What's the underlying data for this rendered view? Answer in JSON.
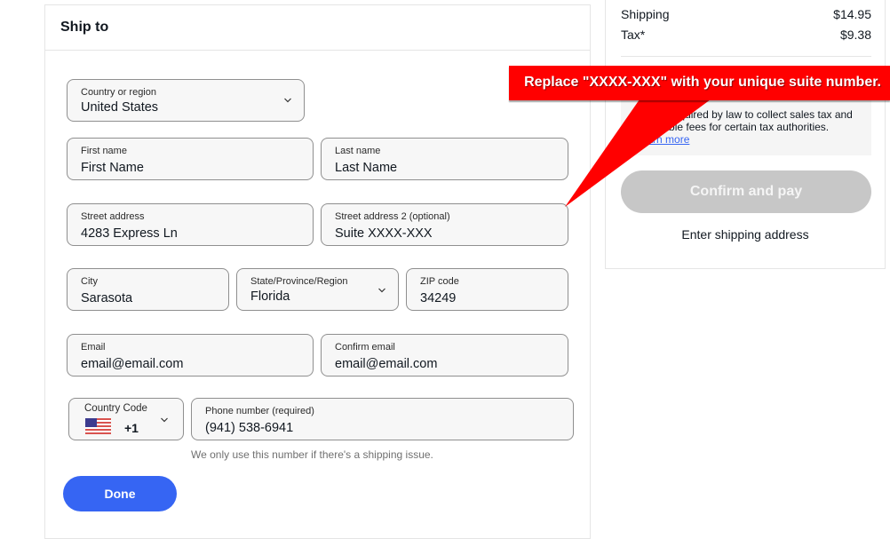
{
  "ship_to": {
    "title": "Ship to",
    "country": {
      "label": "Country or region",
      "value": "United States"
    },
    "first_name": {
      "label": "First name",
      "value": "First Name"
    },
    "last_name": {
      "label": "Last name",
      "value": "Last Name"
    },
    "street": {
      "label": "Street address",
      "value": "4283 Express Ln"
    },
    "street2": {
      "label": "Street address 2 (optional)",
      "value": "Suite XXXX-XXX"
    },
    "city": {
      "label": "City",
      "value": "Sarasota"
    },
    "state": {
      "label": "State/Province/Region",
      "value": "Florida"
    },
    "zip": {
      "label": "ZIP code",
      "value": "34249"
    },
    "email": {
      "label": "Email",
      "value": "email@email.com"
    },
    "confirm_email": {
      "label": "Confirm email",
      "value": "email@email.com"
    },
    "country_code": {
      "label": "Country Code",
      "value": "+1",
      "flag": "us-flag-icon"
    },
    "phone": {
      "label": "Phone number (required)",
      "value": "(941) 538-6941"
    },
    "phone_hint": "We only use this number if there's a shipping issue.",
    "done_label": "Done"
  },
  "summary": {
    "rows": [
      {
        "label": "Shipping",
        "value": "$14.95"
      },
      {
        "label": "Tax*",
        "value": "$9.38"
      }
    ],
    "tax_note": "*We're required by law to collect sales tax and applicable fees for certain tax authorities.",
    "learn_more": "Learn more",
    "confirm_label": "Confirm and pay",
    "enter_address": "Enter shipping address"
  },
  "callout": {
    "text": "Replace \"XXXX-XXX\" with your unique suite number.",
    "color": "#ff0000"
  },
  "colors": {
    "primary": "#3665f3",
    "disabled": "#c7c7c7",
    "field_bg": "#f7f7f7"
  }
}
